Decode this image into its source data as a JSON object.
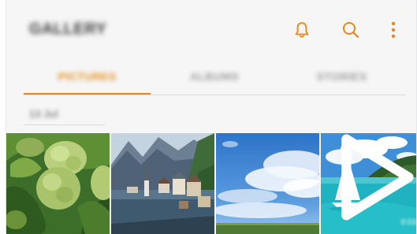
{
  "app": {
    "title": "GALLERY"
  },
  "header": {
    "icons": [
      "bell-icon",
      "search-icon",
      "more-options-icon"
    ]
  },
  "tabs": [
    {
      "label": "PICTURES",
      "selected": true
    },
    {
      "label": "ALBUMS",
      "selected": false
    },
    {
      "label": "STORIES",
      "selected": false
    }
  ],
  "section": {
    "date_label": "13 Jul"
  },
  "thumbnails": [
    {
      "subject": "green hydrangea flowers"
    },
    {
      "subject": "lakeside alpine village"
    },
    {
      "subject": "blue sky with clouds"
    },
    {
      "subject": "sailboat on turquoise sea",
      "is_video": true,
      "duration": "0:03"
    }
  ],
  "colors": {
    "accent": "#e28a1e",
    "background": "#f6f6f7",
    "tab_inactive": "#9d9d9d"
  }
}
